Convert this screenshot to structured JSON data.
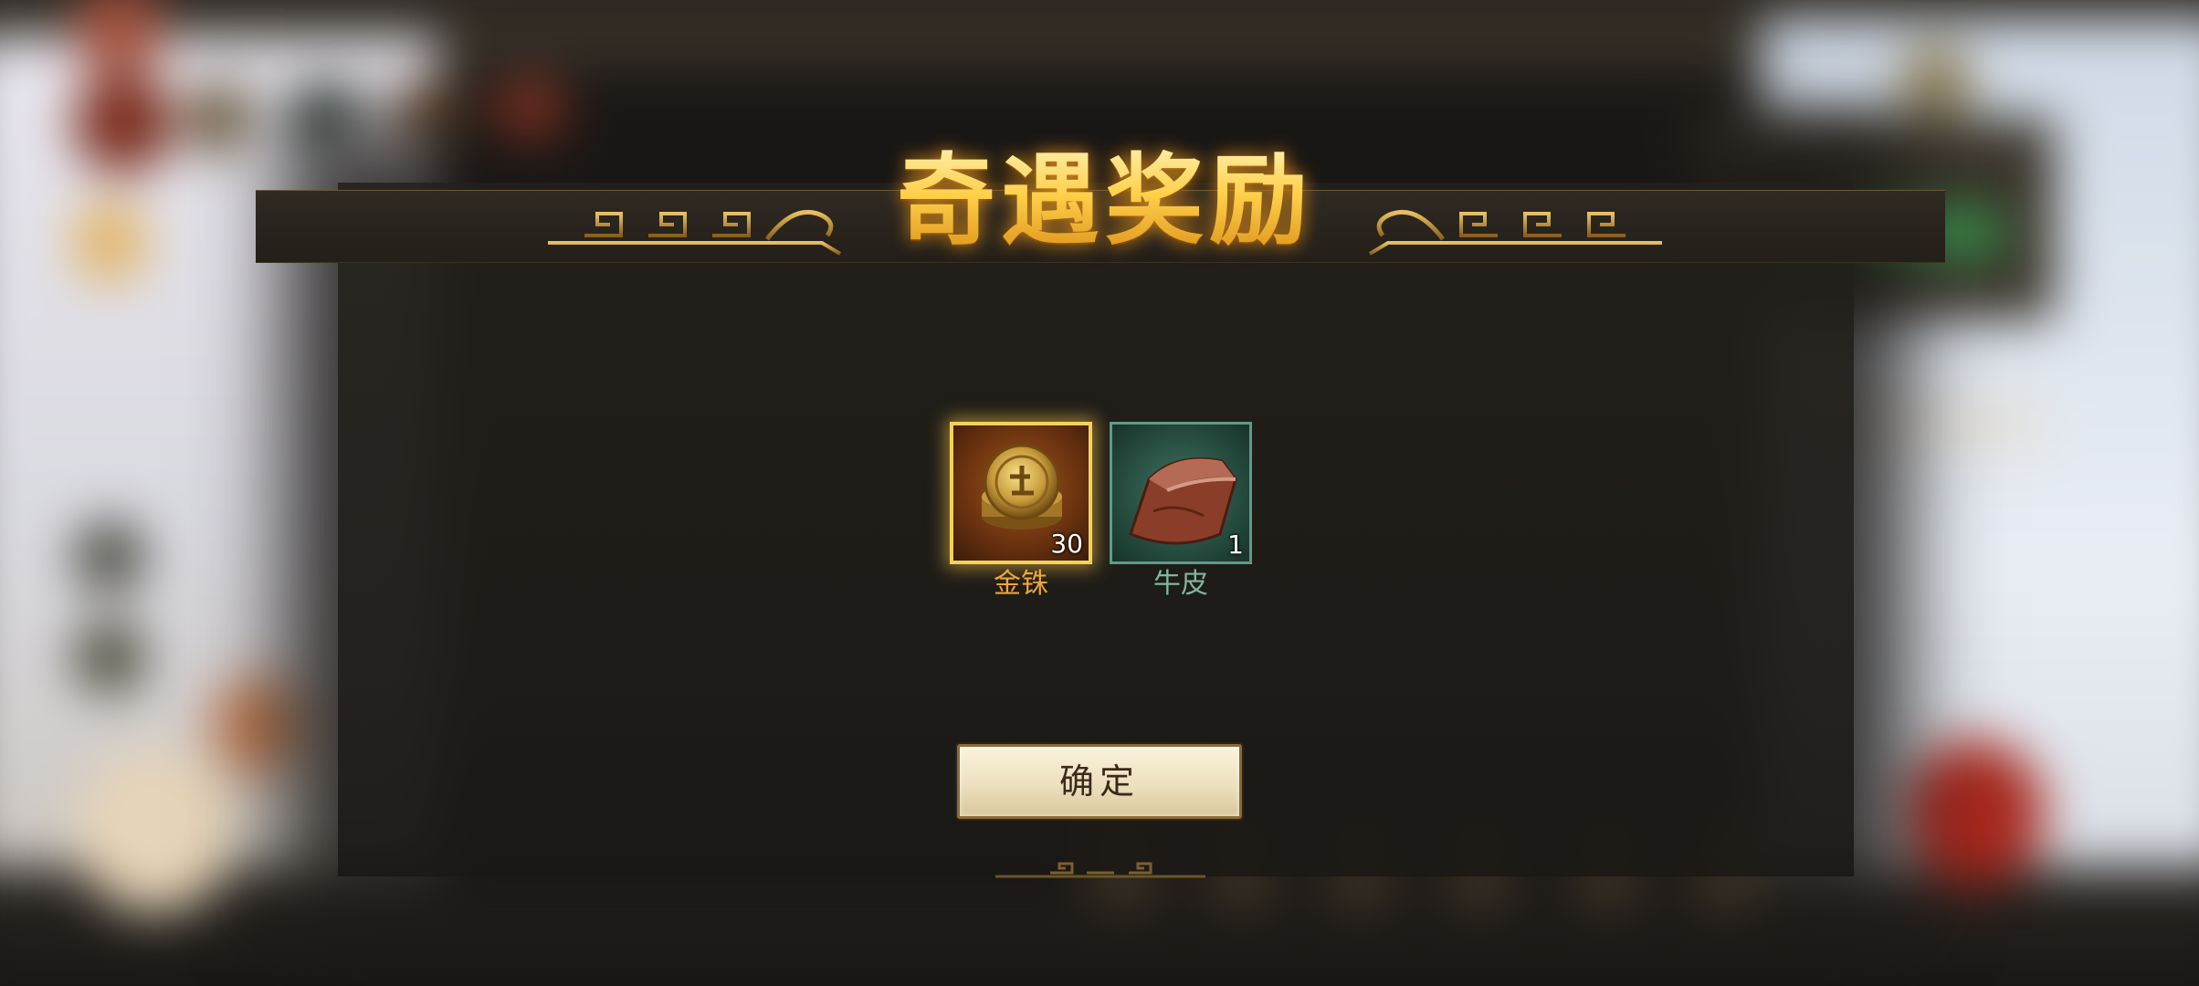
{
  "dialog": {
    "title": "奇遇奖励",
    "confirm_label": "确定"
  },
  "rewards": [
    {
      "name": "金铢",
      "count": "30",
      "icon": "gold-coin-icon",
      "rarity_color": "#f2d25a"
    },
    {
      "name": "牛皮",
      "count": "1",
      "icon": "cowhide-icon",
      "rarity_color": "#5f9a86"
    }
  ],
  "colors": {
    "title_gold": "#ffd35a",
    "gold_item_name": "#f0a43a",
    "green_item_name": "#7fb79f",
    "button_text": "#3b2a18"
  }
}
